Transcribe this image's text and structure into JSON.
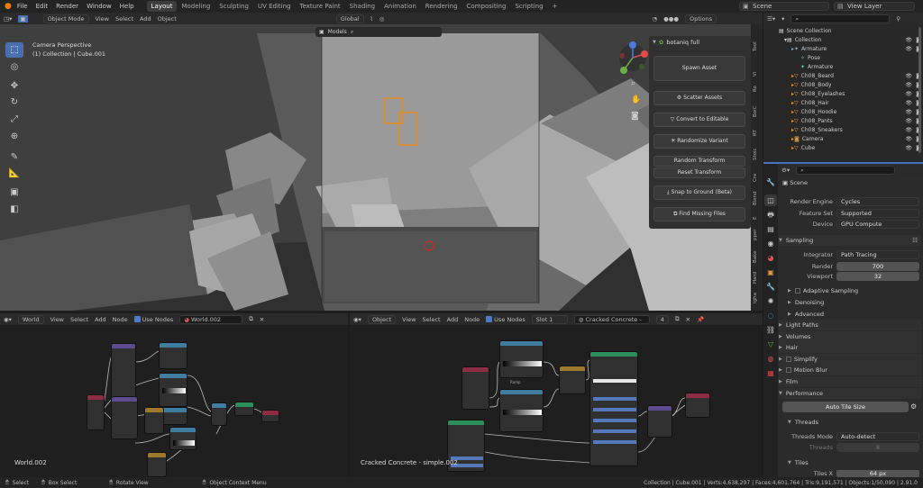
{
  "topbar": {
    "menus": [
      "File",
      "Edit",
      "Render",
      "Window",
      "Help"
    ],
    "workspaces": [
      "Layout",
      "Modeling",
      "Sculpting",
      "UV Editing",
      "Texture Paint",
      "Shading",
      "Animation",
      "Rendering",
      "Compositing",
      "Scripting"
    ],
    "active_workspace": "Layout",
    "add_tab": "+",
    "scene": "Scene",
    "view_layer": "View Layer"
  },
  "viewport": {
    "mode": "Object Mode",
    "menus": [
      "View",
      "Select",
      "Add",
      "Object"
    ],
    "transform_space": "Global",
    "options": "Options",
    "camera_title": "Camera Perspective",
    "collection_info": "(1) Collection | Cube.001",
    "models_label": "Models"
  },
  "botaniq": {
    "title": "botaniq full",
    "buttons": [
      "Spawn Asset",
      "Scatter Assets",
      "Convert to Editable",
      "Randomize Variant",
      "Random Transform",
      "Reset Transform",
      "Snap to Ground (Beta)",
      "Find Missing Files"
    ]
  },
  "side_tabs": [
    "Tool",
    "Vi",
    "Ro",
    "BoiC",
    "RT",
    "Stoic",
    "Cre",
    "Blend",
    "E",
    "pper",
    "Bake",
    "Hard",
    "Igha"
  ],
  "outliner": {
    "root": "Scene Collection",
    "rows": [
      {
        "label": "Collection"
      },
      {
        "label": "Armature"
      },
      {
        "label": "Pose"
      },
      {
        "label": "Armature"
      },
      {
        "label": "Ch08_Beard"
      },
      {
        "label": "Ch08_Body"
      },
      {
        "label": "Ch08_Eyelashes"
      },
      {
        "label": "Ch08_Hair"
      },
      {
        "label": "Ch08_Hoodie"
      },
      {
        "label": "Ch08_Pants"
      },
      {
        "label": "Ch08_Sneakers"
      },
      {
        "label": "Camera"
      },
      {
        "label": "Cube"
      }
    ]
  },
  "properties": {
    "scene_label": "Scene",
    "render_engine": {
      "label": "Render Engine",
      "value": "Cycles"
    },
    "feature_set": {
      "label": "Feature Set",
      "value": "Supported"
    },
    "device": {
      "label": "Device",
      "value": "GPU Compute"
    },
    "sampling": "Sampling",
    "integrator": {
      "label": "Integrator",
      "value": "Path Tracing"
    },
    "render": {
      "label": "Render",
      "value": "700"
    },
    "viewport": {
      "label": "Viewport",
      "value": "32"
    },
    "adaptive_sampling": "Adaptive Sampling",
    "denoising": "Denoising",
    "advanced": "Advanced",
    "light_paths": "Light Paths",
    "volumes": "Volumes",
    "hair": "Hair",
    "simplify": "Simplify",
    "motion_blur": "Motion Blur",
    "film": "Film",
    "performance": "Performance",
    "auto_tile_size": "Auto Tile Size",
    "threads": "Threads",
    "threads_mode": {
      "label": "Threads Mode",
      "value": "Auto-detect"
    },
    "threads_count": {
      "label": "Threads",
      "value": "8"
    },
    "tiles": "Tiles",
    "tiles_x": {
      "label": "Tiles X",
      "value": "64 px"
    }
  },
  "world_editor": {
    "type": "World",
    "menus": [
      "View",
      "Select",
      "Add",
      "Node"
    ],
    "use_nodes": "Use Nodes",
    "world_name": "World.002",
    "footer_label": "World.002"
  },
  "material_editor": {
    "type": "Object",
    "menus": [
      "View",
      "Select",
      "Add",
      "Node"
    ],
    "use_nodes": "Use Nodes",
    "slot": "Slot 1",
    "material_name": "Cracked Concrete -",
    "users": "4",
    "footer_label": "Cracked Concrete - simple.002"
  },
  "statusbar": {
    "items": [
      "Select",
      "Box Select",
      "Rotate View",
      "Object Context Menu"
    ],
    "stats": "Collection | Cube.001 | Verts:4,638,297 | Faces:4,601,764 | Tris:9,191,571 | Objects:1/50,090 | 2.91.0"
  }
}
